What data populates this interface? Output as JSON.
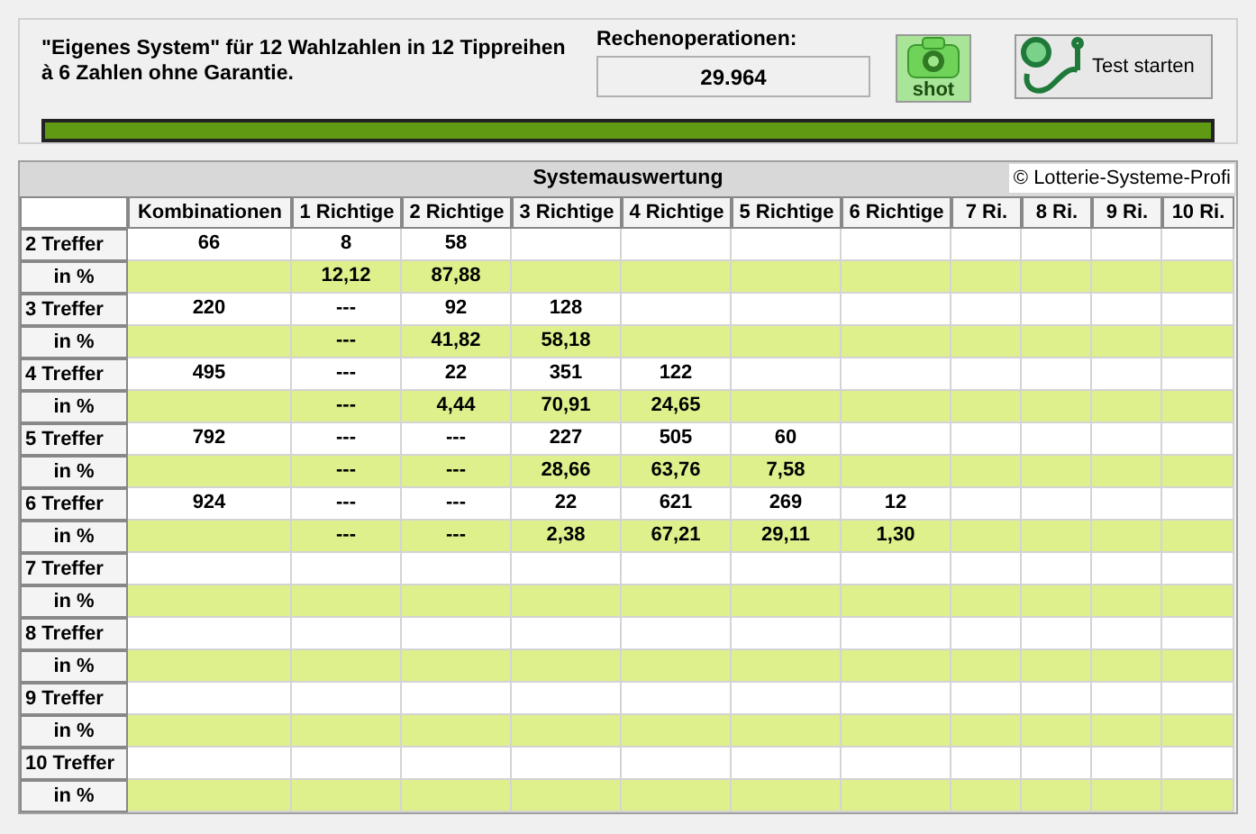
{
  "header": {
    "description": "\"Eigenes System\" für 12 Wahlzahlen in 12 Tippreihen à 6 Zahlen ohne Garantie.",
    "operations_label": "Rechenoperationen:",
    "operations_value": "29.964",
    "shot_button": "shot",
    "test_button": "Test starten"
  },
  "progress": {
    "level": 1
  },
  "table": {
    "title": "Systemauswertung",
    "copyright": "© Lotterie-Systeme-Profi",
    "columns": [
      "Kombinationen",
      "1 Richtige",
      "2 Richtige",
      "3 Richtige",
      "4 Richtige",
      "5 Richtige",
      "6 Richtige",
      "7 Ri.",
      "8 Ri.",
      "9 Ri.",
      "10 Ri."
    ],
    "rows": [
      {
        "kind": "count",
        "label": "2 Treffer",
        "cells": [
          "66",
          "8",
          "58",
          null,
          null,
          null,
          null,
          null,
          null,
          null,
          null
        ]
      },
      {
        "kind": "percent",
        "label": "in %",
        "cells": [
          null,
          "12,12",
          "87,88",
          null,
          null,
          null,
          null,
          null,
          null,
          null,
          null
        ]
      },
      {
        "kind": "count",
        "label": "3 Treffer",
        "cells": [
          "220",
          "---",
          "92",
          "128",
          null,
          null,
          null,
          null,
          null,
          null,
          null
        ]
      },
      {
        "kind": "percent",
        "label": "in %",
        "cells": [
          null,
          "---",
          "41,82",
          "58,18",
          null,
          null,
          null,
          null,
          null,
          null,
          null
        ]
      },
      {
        "kind": "count",
        "label": "4 Treffer",
        "cells": [
          "495",
          "---",
          "22",
          "351",
          "122",
          null,
          null,
          null,
          null,
          null,
          null
        ]
      },
      {
        "kind": "percent",
        "label": "in %",
        "cells": [
          null,
          "---",
          "4,44",
          "70,91",
          "24,65",
          null,
          null,
          null,
          null,
          null,
          null
        ]
      },
      {
        "kind": "count",
        "label": "5 Treffer",
        "cells": [
          "792",
          "---",
          "---",
          "227",
          "505",
          "60",
          null,
          null,
          null,
          null,
          null
        ]
      },
      {
        "kind": "percent",
        "label": "in %",
        "cells": [
          null,
          "---",
          "---",
          "28,66",
          "63,76",
          "7,58",
          null,
          null,
          null,
          null,
          null
        ]
      },
      {
        "kind": "count",
        "label": "6 Treffer",
        "cells": [
          "924",
          "---",
          "---",
          "22",
          "621",
          "269",
          "12",
          null,
          null,
          null,
          null
        ]
      },
      {
        "kind": "percent",
        "label": "in %",
        "cells": [
          null,
          "---",
          "---",
          "2,38",
          "67,21",
          "29,11",
          "1,30",
          null,
          null,
          null,
          null
        ]
      },
      {
        "kind": "count",
        "label": "7 Treffer"
      },
      {
        "kind": "percent",
        "label": "in %"
      },
      {
        "kind": "count",
        "label": "8 Treffer"
      },
      {
        "kind": "percent",
        "label": "in %"
      },
      {
        "kind": "count",
        "label": "9 Treffer"
      },
      {
        "kind": "percent",
        "label": "in %"
      },
      {
        "kind": "count",
        "label": "10 Treffer"
      },
      {
        "kind": "percent",
        "label": "in %"
      }
    ]
  }
}
